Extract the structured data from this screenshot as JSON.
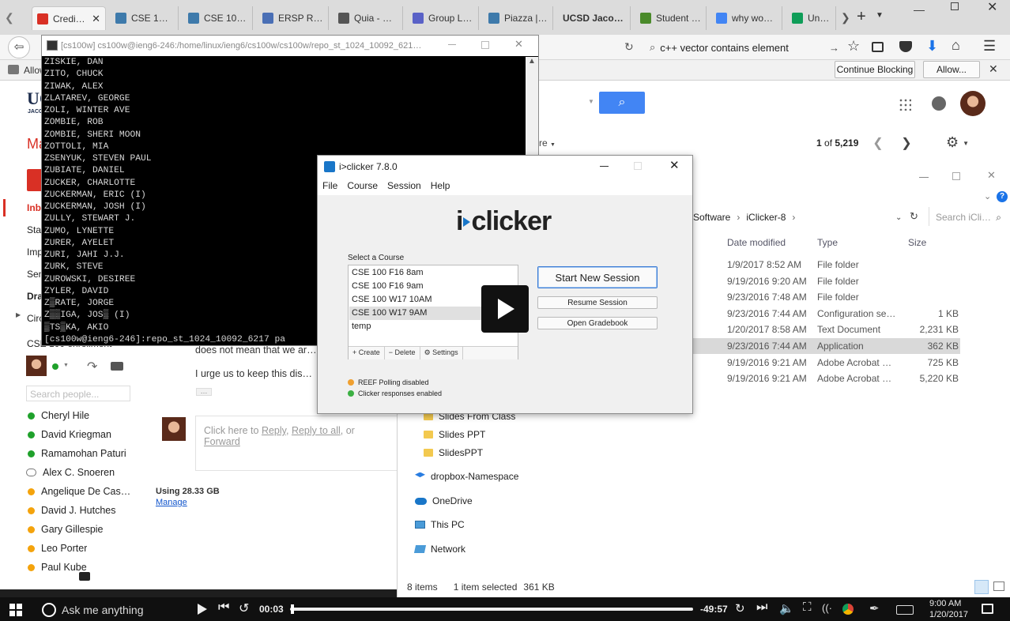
{
  "tabs": [
    {
      "label": "Credi…",
      "icon": "gmail-icon",
      "color": "#d93025"
    },
    {
      "label": "CSE 100 (…",
      "icon": "piazza-icon",
      "color": "#3e7aab"
    },
    {
      "label": "CSE 100 (…",
      "icon": "piazza-icon",
      "color": "#3e7aab"
    },
    {
      "label": "ERSP Res…",
      "icon": "doc-icon",
      "color": "#4a6fb5"
    },
    {
      "label": "Quia - Qu…",
      "icon": "quia-icon",
      "color": "#555555"
    },
    {
      "label": "Group Lo…",
      "icon": "forms-icon",
      "color": "#5a62c7"
    },
    {
      "label": "Piazza | C…",
      "icon": "piazza-icon",
      "color": "#3e7aab"
    },
    {
      "label": "UCSD Jacob…",
      "icon": "",
      "color": ""
    },
    {
      "label": "Student p…",
      "icon": "gear-green-icon",
      "color": "#4a8a2a"
    },
    {
      "label": "why wom…",
      "icon": "google-icon",
      "color": "#4285f4"
    },
    {
      "label": "Untitled",
      "icon": "sheets-icon",
      "color": "#0f9d58"
    }
  ],
  "address_search": "c++ vector contains element",
  "infobar": {
    "prefix": "Allow",
    "continue_blocking": "Continue Blocking",
    "allow": "Allow..."
  },
  "gmail": {
    "logo_top": "UC",
    "logo_sub": "JACO",
    "mail_label": "Ma",
    "nav": [
      "Inbo",
      "Star",
      "Imp",
      "Sen",
      "Draf",
      "Circ"
    ],
    "label_cse": "CSE 100 enrollment",
    "search_people": "Search people...",
    "contacts": [
      {
        "name": "Cheryl Hile",
        "status": "#1fa12b"
      },
      {
        "name": "David Kriegman",
        "status": "#1fa12b"
      },
      {
        "name": "Ramamohan Paturi",
        "status": "#1fa12b"
      },
      {
        "name": "Alex C. Snoeren",
        "status": "chat"
      },
      {
        "name": "Angelique De Cas…",
        "status": "#f4a30c"
      },
      {
        "name": "David J. Hutches",
        "status": "#f4a30c"
      },
      {
        "name": "Gary Gillespie",
        "status": "#f4a30c"
      },
      {
        "name": "Leo Porter",
        "status": "#f4a30c"
      },
      {
        "name": "Paul Kube",
        "status": "#f4a30c"
      }
    ],
    "pagination": "1 of 5,219",
    "pagination_bold": "1",
    "pagination_total": "5,219",
    "more_label": "re",
    "body_line1": "does not mean that we are a",
    "body_line2": "I urge us to keep this discuss",
    "ellipsis": "…",
    "reply_prefix": "Click here to ",
    "reply": "Reply",
    "reply_all": "Reply to all",
    "or": ", or ",
    "forward": "Forward",
    "storage": "Using 28.33 GB",
    "manage": "Manage"
  },
  "terminal": {
    "title": "[cs100w] cs100w@ieng6-246:/home/linux/ieng6/cs100w/cs100w/repo_st_1024_10092_621…",
    "lines": [
      "ZISKIE, DAN",
      "ZITO, CHUCK",
      "ZIWAK, ALEX",
      "ZLATAREV, GEORGE",
      "ZOLI, WINTER AVE",
      "ZOMBIE, ROB",
      "ZOMBIE, SHERI MOON",
      "ZOTTOLI, MIA",
      "ZSENYUK, STEVEN PAUL",
      "ZUBIATE, DANIEL",
      "ZUCKER, CHARLOTTE",
      "ZUCKERMAN, ERIC (I)",
      "ZUCKERMAN, JOSH (I)",
      "ZULLY, STEWART J.",
      "ZUMO, LYNETTE",
      "ZURER, AYELET",
      "ZURI, JAHI J.J.",
      "ZURK, STEVE",
      "ZUROWSKI, DESIREE",
      "ZYLER, DAVID",
      "Z▒RATE, JORGE",
      "Z▒▒IGA, JOS▒ (I)",
      "▒TS▒KA, AKIO",
      "[cs100w@ieng6-246]:repo_st_1024_10092_6217 pa"
    ]
  },
  "explorer": {
    "breadcrumb": [
      "Software",
      "iClicker-8"
    ],
    "search_placeholder": "Search iCli…",
    "columns": [
      "Date modified",
      "Type",
      "Size"
    ],
    "rows": [
      {
        "date": "1/9/2017 8:52 AM",
        "type": "File folder",
        "size": ""
      },
      {
        "date": "9/19/2016 9:20 AM",
        "type": "File folder",
        "size": ""
      },
      {
        "date": "9/23/2016 7:48 AM",
        "type": "File folder",
        "size": ""
      },
      {
        "date": "9/23/2016 7:44 AM",
        "type": "Configuration setti…",
        "size": "1 KB"
      },
      {
        "date": "1/20/2017 8:58 AM",
        "type": "Text Document",
        "size": "2,231 KB"
      },
      {
        "date": "9/23/2016 7:44 AM",
        "type": "Application",
        "size": "362 KB"
      },
      {
        "date": "9/19/2016 9:21 AM",
        "type": "Adobe Acrobat D…",
        "size": "725 KB"
      },
      {
        "date": "9/19/2016 9:21 AM",
        "type": "Adobe Acrobat D…",
        "size": "5,220 KB"
      }
    ],
    "tree": [
      {
        "label": "Slides From Class",
        "icon": "folder-icon"
      },
      {
        "label": "Slides PPT",
        "icon": "folder-icon"
      },
      {
        "label": "SlidesPPT",
        "icon": "folder-icon"
      },
      {
        "label": "dropbox-Namespace",
        "icon": "dropbox-icon"
      },
      {
        "label": "OneDrive",
        "icon": "onedrive-icon"
      },
      {
        "label": "This PC",
        "icon": "pc-icon"
      },
      {
        "label": "Network",
        "icon": "network-icon"
      }
    ],
    "status_items": "8 items",
    "status_selected": "1 item selected",
    "status_size": "361 KB"
  },
  "iclicker": {
    "title": "i>clicker 7.8.0",
    "menu": [
      "File",
      "Course",
      "Session",
      "Help"
    ],
    "logo": "iclicker",
    "logo_i": "i",
    "logo_rest": "clicker",
    "select_label": "Select a Course",
    "courses": [
      "CSE 100 F16 8am",
      "CSE 100 F16 9am",
      "CSE 100 W17 10AM",
      "CSE 100 W17 9AM",
      "temp"
    ],
    "selected_index": 3,
    "create": "Create",
    "delete": "Delete",
    "settings": "Settings",
    "start": "Start New Session",
    "resume": "Resume Session",
    "gradebook": "Open Gradebook",
    "status1": "REEF Polling disabled",
    "status1_color": "#f0a030",
    "status2": "Clicker responses enabled",
    "status2_color": "#3cb043"
  },
  "player": {
    "elapsed": "00:03",
    "remaining": "-49:57",
    "progress": 0.001,
    "clock_time": "9:00 AM",
    "clock_date": "1/20/2017",
    "cortana": "Ask me anything"
  }
}
